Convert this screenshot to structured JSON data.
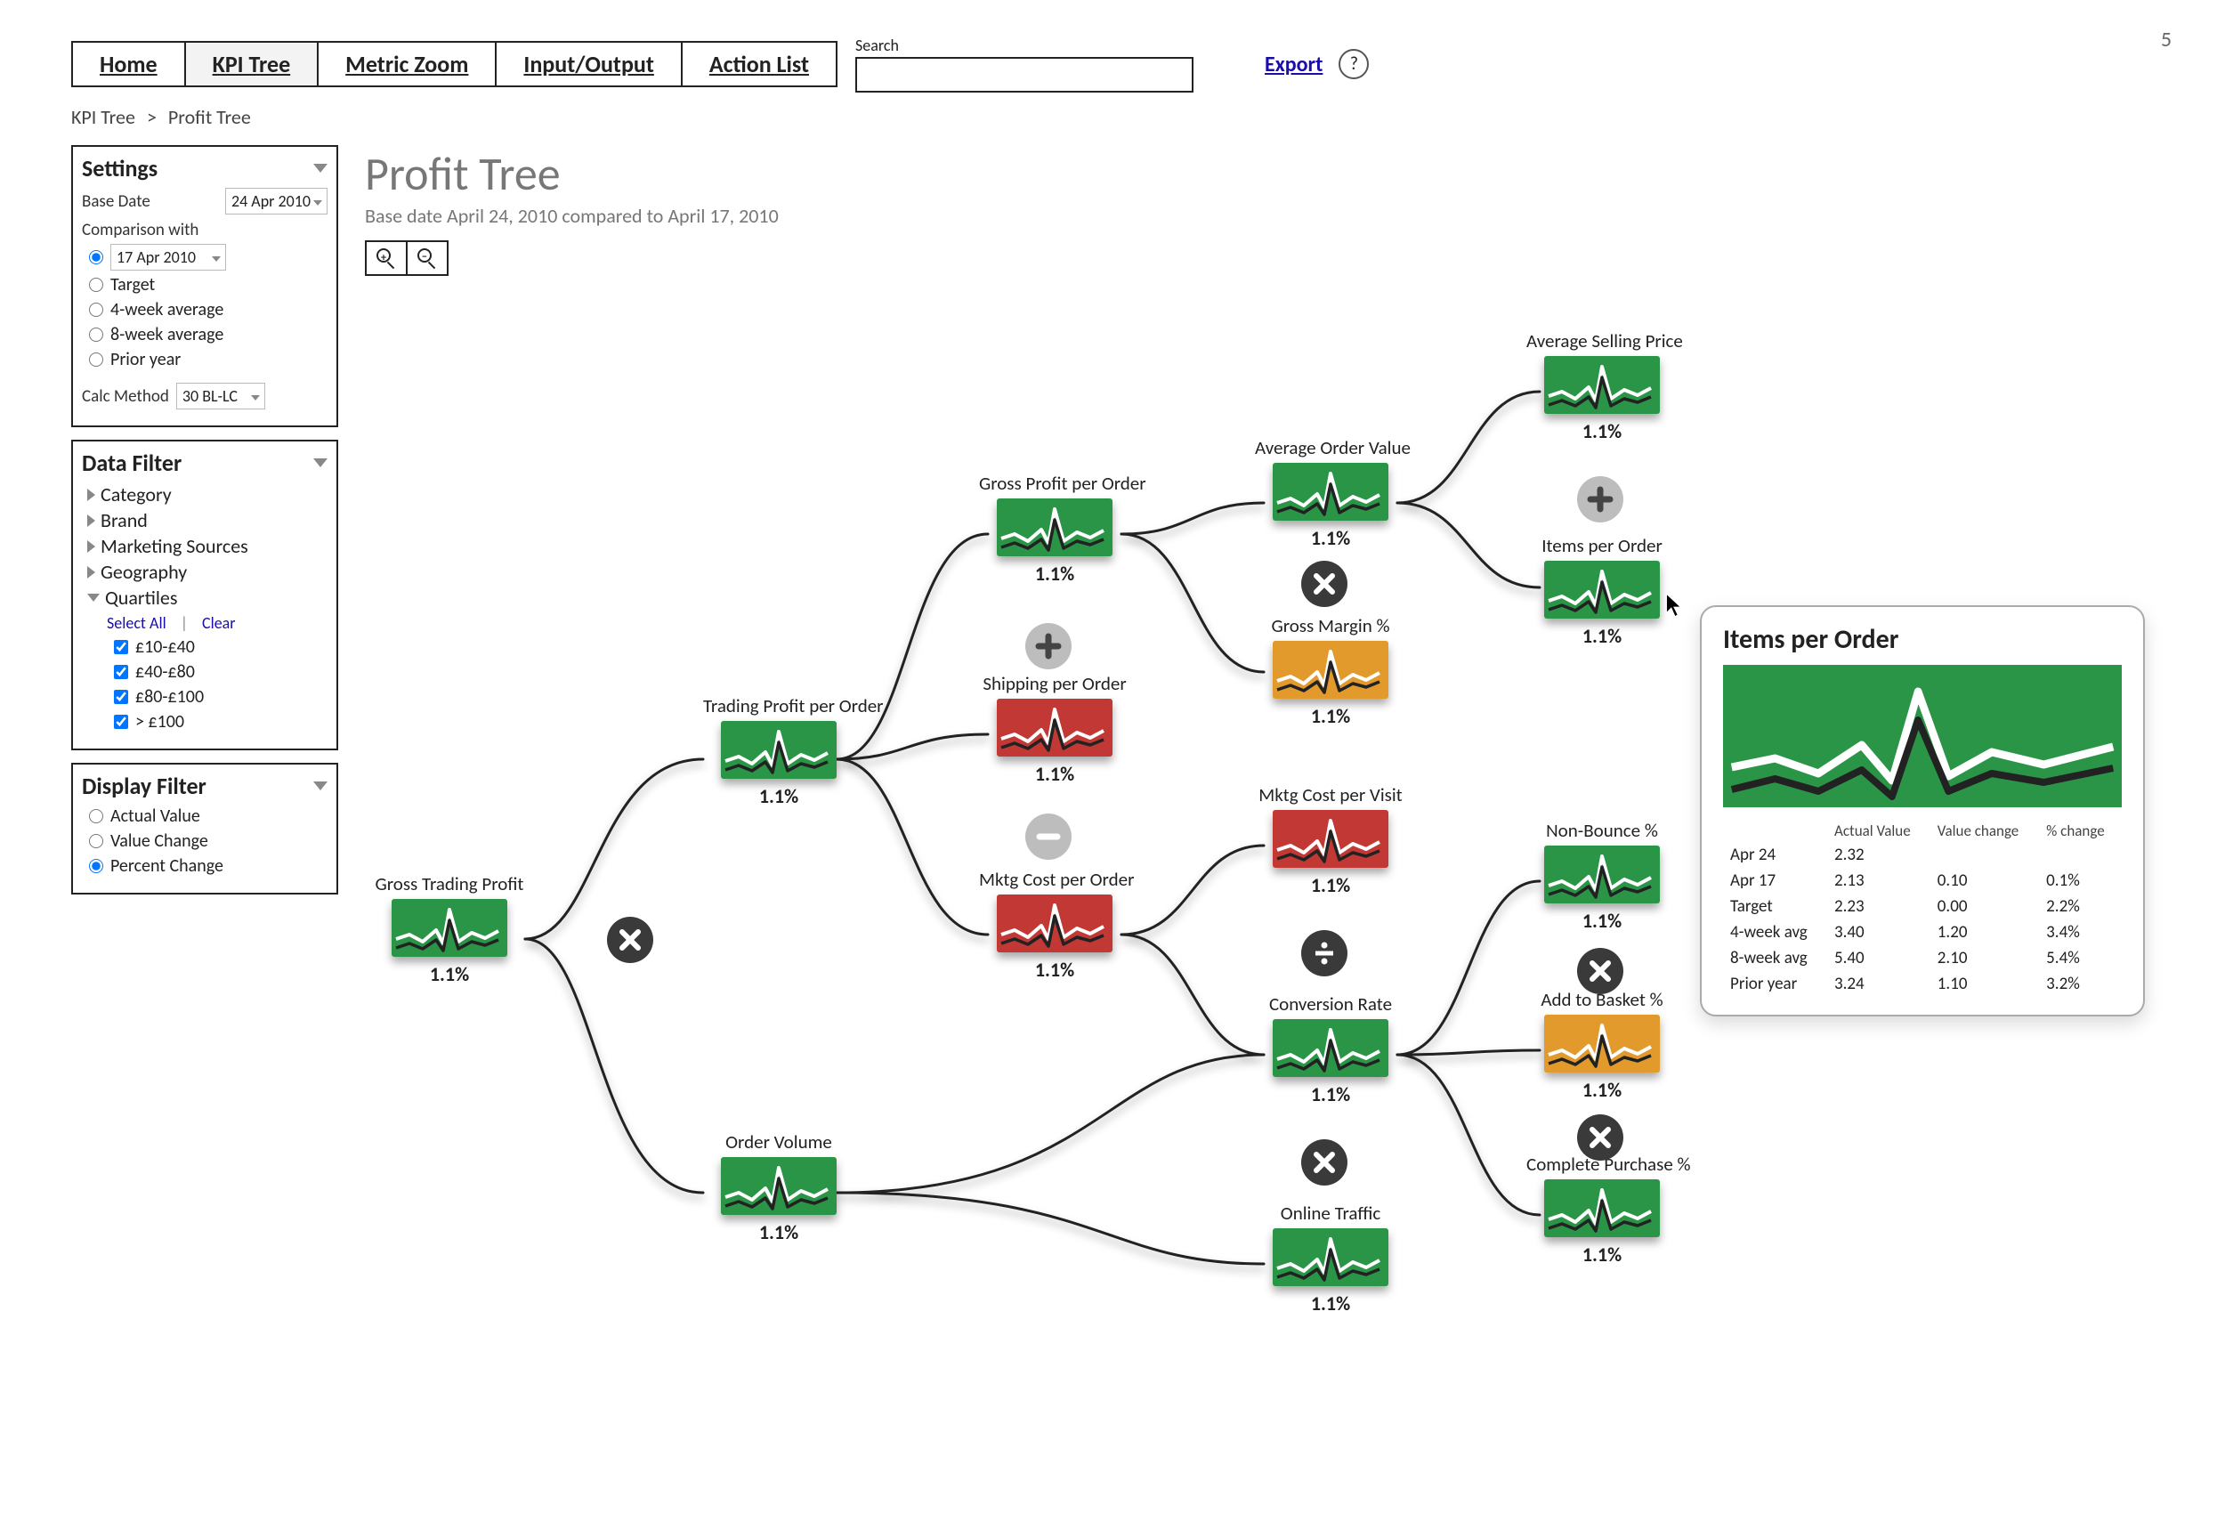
{
  "page_number": "5",
  "nav": {
    "tabs": [
      "Home",
      "KPI Tree",
      "Metric Zoom",
      "Input/Output",
      "Action List"
    ],
    "active": "KPI Tree",
    "search_label": "Search",
    "export": "Export",
    "help": "?"
  },
  "breadcrumb": {
    "root": "KPI Tree",
    "current": "Profit Tree"
  },
  "header": {
    "title": "Profit Tree",
    "subtitle": "Base date  April 24, 2010 compared to April 17, 2010"
  },
  "settings": {
    "title": "Settings",
    "base_date_label": "Base Date",
    "base_date_value": "24 Apr 2010",
    "comparison_label": "Comparison with",
    "options": [
      {
        "label": "17 Apr 2010",
        "checked": true,
        "has_dropdown": true
      },
      {
        "label": "Target",
        "checked": false
      },
      {
        "label": "4-week average",
        "checked": false
      },
      {
        "label": "8-week average",
        "checked": false
      },
      {
        "label": "Prior year",
        "checked": false
      }
    ],
    "calc_label": "Calc Method",
    "calc_value": "30 BL-LC"
  },
  "data_filter": {
    "title": "Data Filter",
    "items": [
      "Category",
      "Brand",
      "Marketing Sources",
      "Geography"
    ],
    "quartiles_label": "Quartiles",
    "select_all": "Select All",
    "clear": "Clear",
    "quartiles": [
      "£10-£40",
      "£40-£80",
      "£80-£100",
      "> £100"
    ]
  },
  "display_filter": {
    "title": "Display Filter",
    "options": [
      {
        "label": "Actual Value",
        "checked": false
      },
      {
        "label": "Value Change",
        "checked": false
      },
      {
        "label": "Percent Change",
        "checked": true
      }
    ]
  },
  "nodes": {
    "gtp": {
      "title": "Gross Trading Profit",
      "value": "1.1%",
      "color": "green"
    },
    "tpo": {
      "title": "Trading Profit per Order",
      "value": "1.1%",
      "color": "green"
    },
    "ov": {
      "title": "Order Volume",
      "value": "1.1%",
      "color": "green"
    },
    "gpo": {
      "title": "Gross Profit per Order",
      "value": "1.1%",
      "color": "green"
    },
    "spo": {
      "title": "Shipping per Order",
      "value": "1.1%",
      "color": "red"
    },
    "mco": {
      "title": "Mktg Cost per Order",
      "value": "1.1%",
      "color": "red"
    },
    "aov": {
      "title": "Average Order Value",
      "value": "1.1%",
      "color": "green"
    },
    "gm": {
      "title": "Gross Margin %",
      "value": "1.1%",
      "color": "orange"
    },
    "mcv": {
      "title": "Mktg Cost per Visit",
      "value": "1.1%",
      "color": "red"
    },
    "cr": {
      "title": "Conversion Rate",
      "value": "1.1%",
      "color": "green"
    },
    "ot": {
      "title": "Online Traffic",
      "value": "1.1%",
      "color": "green"
    },
    "asp": {
      "title": "Average Selling Price",
      "value": "1.1%",
      "color": "green"
    },
    "ipo": {
      "title": "Items per Order",
      "value": "1.1%",
      "color": "green"
    },
    "nb": {
      "title": "Non-Bounce %",
      "value": "1.1%",
      "color": "green"
    },
    "atb": {
      "title": "Add to Basket %",
      "value": "1.1%",
      "color": "orange"
    },
    "cp": {
      "title": "Complete Purchase %",
      "value": "1.1%",
      "color": "green"
    }
  },
  "tooltip": {
    "title": "Items per Order",
    "cols": [
      "",
      "Actual Value",
      "Value change",
      "% change"
    ],
    "rows": [
      {
        "label": "Apr 24",
        "actual": "2.32",
        "vchange": "",
        "pchange": ""
      },
      {
        "label": "Apr 17",
        "actual": "2.13",
        "vchange": "0.10",
        "pchange": "0.1%"
      },
      {
        "label": "Target",
        "actual": "2.23",
        "vchange": "0.00",
        "pchange": "2.2%"
      },
      {
        "label": "4-week avg",
        "actual": "3.40",
        "vchange": "1.20",
        "pchange": "3.4%"
      },
      {
        "label": "8-week avg",
        "actual": "5.40",
        "vchange": "2.10",
        "pchange": "5.4%"
      },
      {
        "label": "Prior year",
        "actual": "3.24",
        "vchange": "1.10",
        "pchange": "3.2%"
      }
    ]
  }
}
